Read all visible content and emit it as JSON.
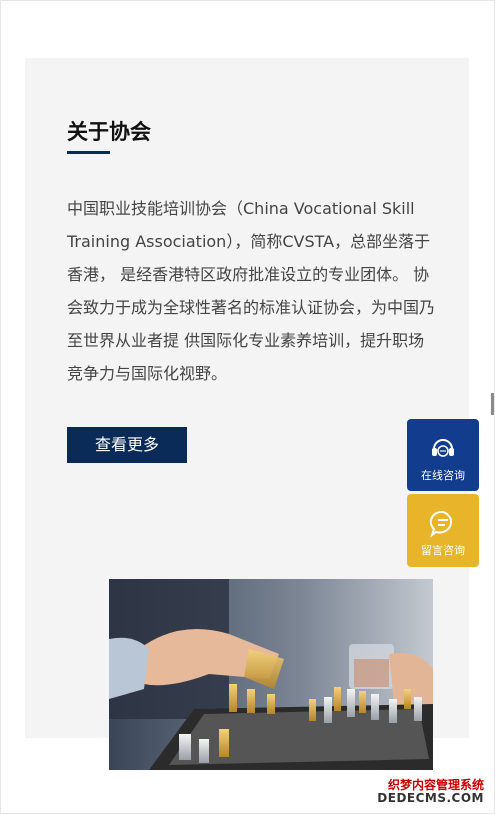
{
  "about": {
    "title": "关于协会",
    "description": "中国职业技能培训协会（China Vocational Skill Training Association），简称CVSTA，总部坐落于香港， 是经香港特区政府批准设立的专业团体。 协会致力于成为全球性著名的标准认证协会，为中国乃至世界从业者提 供国际化专业素养培训，提升职场竞争力与国际化视野。",
    "more_label": "查看更多"
  },
  "float_panel": {
    "online_label": "在线咨询",
    "message_label": "留言咨询"
  },
  "watermark": {
    "line1": "织梦内容管理系统",
    "line2": "DEDECMS.COM"
  },
  "colors": {
    "accent": "#0a2a57",
    "online_bg": "#123c8e",
    "message_bg": "#e8b52a"
  }
}
